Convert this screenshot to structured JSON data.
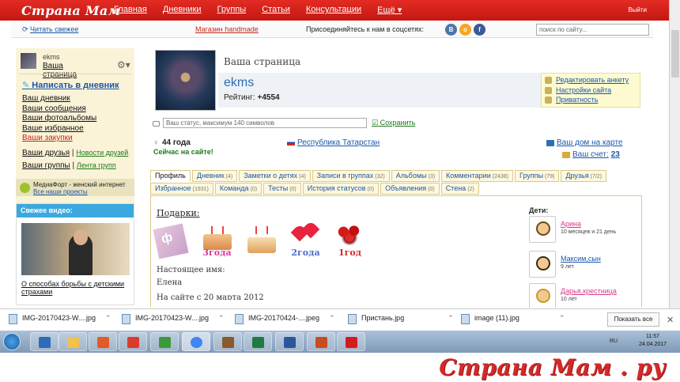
{
  "header": {
    "logo": "Страна Мам",
    "nav": [
      "Главная",
      "Дневники",
      "Группы",
      "Статьи",
      "Консультации",
      "Ещё ▾"
    ],
    "exit": "Выйти"
  },
  "subbar": {
    "refresh": "Читать свежее",
    "shop": "Магазин handmade",
    "join": "Присоединяйтесь к нам в соцсетях:",
    "social": [
      "В",
      "о",
      "f"
    ],
    "social_colors": [
      "#4a76a8",
      "#f5a623",
      "#3b5998"
    ],
    "search_placeholder": "поиск по сайту..."
  },
  "sidebar": {
    "username": "ekms",
    "my_page": "Ваша страница",
    "write": "Написать в дневник",
    "links": [
      "Ваш дневник",
      "Ваши сообщения",
      "Ваши фотоальбомы",
      "Ваше избранное",
      "Ваши закупки"
    ],
    "friends": "Ваши друзья",
    "friends_news": "Новости друзей",
    "groups": "Ваши группы",
    "groups_feed": "Лента групп",
    "mf_line1": "МедиаФорт - женский интернет",
    "mf_line2": "Все наши проекты",
    "video_title": "Свежее видео:",
    "video_caption": "О способах борьбы с детскими страхами"
  },
  "profile": {
    "page_heading": "Ваша страница",
    "name": "ekms",
    "rating_label": "Рейтинг:",
    "rating_value": "+4554",
    "actions": [
      "Редактировать анкету",
      "Настройки сайта",
      "Приватность"
    ],
    "status_placeholder": "Ваш статус, максимум 140 символов",
    "save": "Сохранить",
    "age": "44 года",
    "online": "Сейчас на сайте!",
    "region": "Республика Татарстан",
    "home": "Ваш дом на карте",
    "account_label": "Ваш счет:",
    "account_value": "23"
  },
  "tabs": {
    "row1": [
      {
        "label": "Профиль",
        "count": ""
      },
      {
        "label": "Дневник",
        "count": "(4)"
      },
      {
        "label": "Заметки о детях",
        "count": "(4)"
      },
      {
        "label": "Записи в группах",
        "count": "(32)"
      },
      {
        "label": "Альбомы",
        "count": "(3)"
      },
      {
        "label": "Комментарии",
        "count": "(2438)"
      },
      {
        "label": "Группы",
        "count": "(79)"
      },
      {
        "label": "Друзья",
        "count": "(7/2)"
      }
    ],
    "row2": [
      {
        "label": "Избранное",
        "count": "(1931)"
      },
      {
        "label": "Команда",
        "count": "(0)"
      },
      {
        "label": "Тесты",
        "count": "(0)"
      },
      {
        "label": "История статусов",
        "count": "(0)"
      },
      {
        "label": "Объявления",
        "count": "(0)"
      },
      {
        "label": "Стена",
        "count": "(2)"
      }
    ]
  },
  "content": {
    "gifts_label": "Подарки:",
    "gifts": [
      "ф",
      "3года",
      "",
      "2года",
      "1год"
    ],
    "real_name_label": "Настоящее имя:",
    "real_name": "Елена",
    "since": "На сайте с 20 марта 2012",
    "kids_label": "Дети:",
    "kids": [
      {
        "name": "Арина",
        "age": "10 месяцев и 21 день"
      },
      {
        "name": "Максим,сын",
        "age": "9 лет"
      },
      {
        "name": "Дарья,крестница",
        "age": "10 лет"
      }
    ]
  },
  "downloads": {
    "files": [
      "IMG-20170423-W....jpg",
      "IMG-20170423-W....jpg",
      "IMG-20170424-....jpeg",
      "Пристань.jpg",
      "image (11).jpg"
    ],
    "show_all": "Показать все"
  },
  "taskbar": {
    "lang": "RU",
    "time": "11:57",
    "date": "24.04.2017",
    "icon_colors": [
      "#2f6cb7",
      "#f2c14e",
      "#e05a2a",
      "#d93c2c",
      "#3c9a3c",
      "#4285f4",
      "#8a5a2a",
      "#1e7b43",
      "#2b579a",
      "#c94b20",
      "#d21c1c"
    ]
  },
  "watermark": "Страна Мам . ру"
}
